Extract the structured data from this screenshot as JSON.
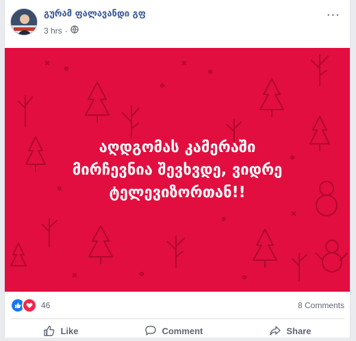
{
  "post": {
    "author": "გურამ ფალავანდი გფ",
    "time": "3 hrs",
    "privacy_icon": "globe-icon",
    "more_icon": "more-options-icon",
    "more_label": "···"
  },
  "banner": {
    "background": "#e10e3f",
    "lines": [
      "აღდგომას კამერაში",
      "მირჩევნია შევხვდე, ვიდრე",
      "ტელევიზორთან!!"
    ]
  },
  "reactions": {
    "count": "46",
    "icons": [
      "like-icon",
      "love-icon"
    ],
    "comments": "8 Comments"
  },
  "actions": {
    "like": "Like",
    "comment": "Comment",
    "share": "Share"
  }
}
